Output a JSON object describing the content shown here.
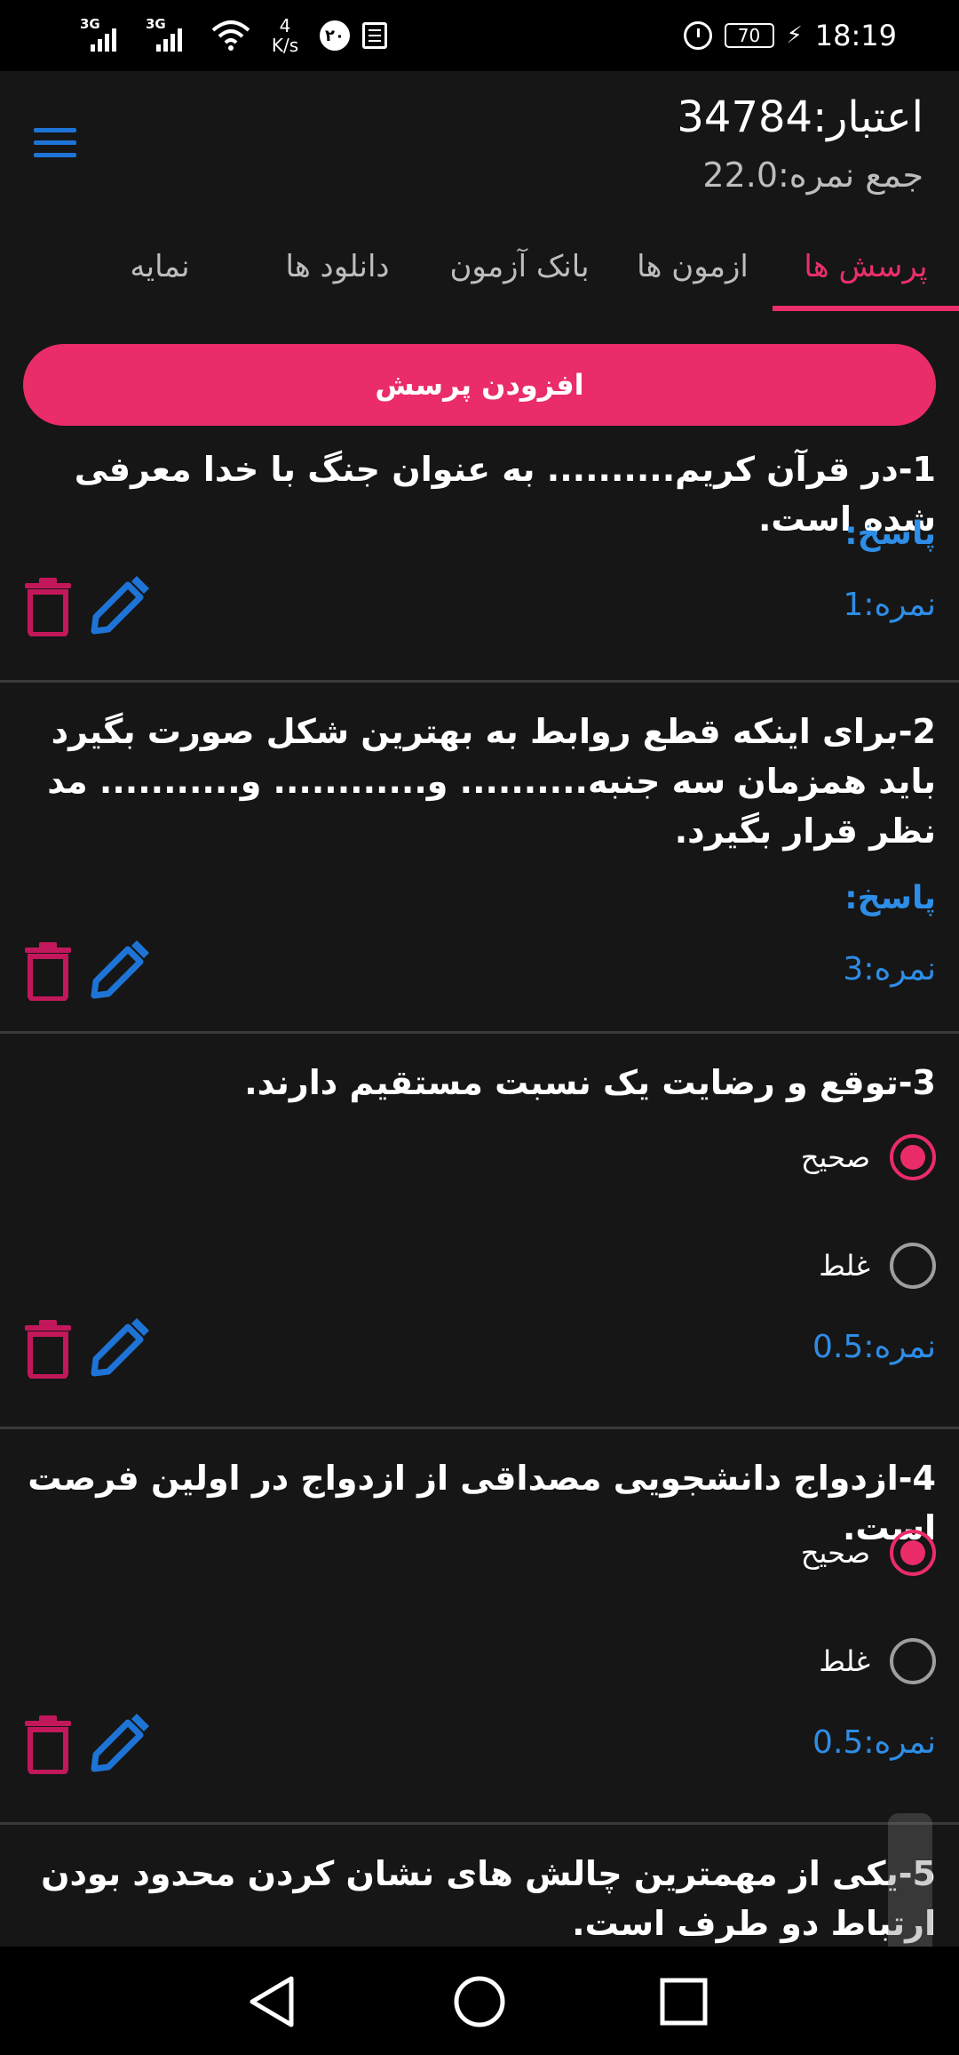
{
  "status_bar": {
    "sim1": "3G",
    "sim2": "3G",
    "speed_value": "4",
    "speed_unit": "K/s",
    "notif_badge": "۲۰",
    "battery": "70",
    "time": "18:19"
  },
  "header": {
    "credit": "اعتبار:34784",
    "total_score": "جمع نمره:22.0",
    "menu_icon": "hamburger-menu-icon"
  },
  "tabs": [
    {
      "label": "پرسش ها",
      "active": true
    },
    {
      "label": "ازمون ها",
      "active": false
    },
    {
      "label": "بانک آزمون",
      "active": false
    },
    {
      "label": "دانلود ها",
      "active": false
    },
    {
      "label": "نمایه",
      "active": false
    }
  ],
  "add_question_label": "افزودن پرسش",
  "questions": [
    {
      "text": "1-در قرآن کریم.......... به عنوان جنگ با خدا معرفی شده است.",
      "answer_label": "پاسخ:",
      "score": "نمره:1"
    },
    {
      "text": "2-برای اینکه قطع روابط به بهترین شکل صورت بگیرد باید همزمان سه جنبه.......... و............ و........... مد نظر قرار بگیرد.",
      "answer_label": "پاسخ:",
      "score": "نمره:3"
    },
    {
      "text": "3-توقع و رضایت یک نسبت مستقیم دارند.",
      "options": [
        {
          "label": "صحیح",
          "selected": true
        },
        {
          "label": "غلط",
          "selected": false
        }
      ],
      "score": "نمره:0.5"
    },
    {
      "text": "4-ازدواج دانشجویی مصداقی از ازدواج در اولین فرصت است.",
      "options": [
        {
          "label": "صحیح",
          "selected": true
        },
        {
          "label": "غلط",
          "selected": false
        }
      ],
      "score": "نمره:0.5"
    },
    {
      "text": "5-یکی از مهمترین چالش های نشان کردن محدود بودن ارتباط دو طرف است."
    }
  ],
  "colors": {
    "accent": "#ea2c69",
    "link_blue": "#2e8de6",
    "delete_red": "#c2185b",
    "background": "#161616"
  },
  "icons": {
    "delete": "trash-icon",
    "edit": "pencil-icon",
    "back": "back-triangle-icon",
    "home": "home-circle-icon",
    "recents": "recents-square-icon"
  }
}
